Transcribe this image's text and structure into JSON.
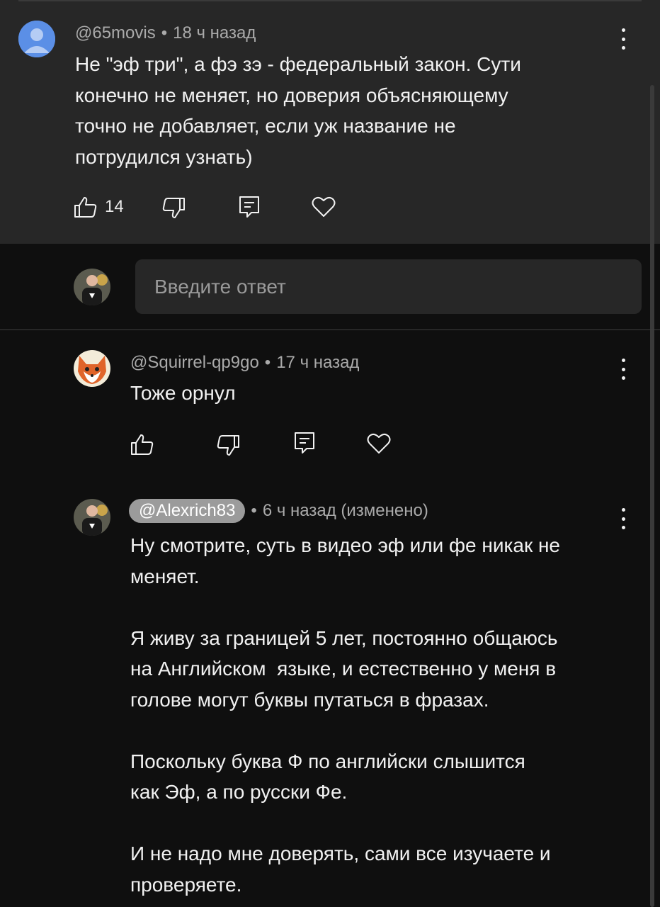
{
  "comment": {
    "author": "@65movis",
    "time": "18 ч назад",
    "text": "Не \"эф три\", а фэ зэ - федеральный закон. Сути\nконечно не меняет, но доверия объясняющему\nточно не добавляет, если уж название не\nпотрудился узнать)",
    "likes": "14",
    "avatar_color": "#4a7fd4"
  },
  "reply_input": {
    "placeholder": "Введите ответ"
  },
  "replies": [
    {
      "author": "@Squirrel-qp9go",
      "time": "17 ч назад",
      "text": "Тоже орнул"
    },
    {
      "author": "@Alexrich83",
      "time": "6 ч назад (изменено)",
      "text": "Ну смотрите, суть в видео эф или фе никак не\nменяет.\n\nЯ живу за границей 5 лет, постоянно общаюсь\nна Английском  языке, и естественно у меня в\nголове могут буквы путаться в фразах.\n\nПоскольку буква Ф по английски слышится\nкак Эф, а по русски Фе.\n\nИ не надо мне доверять, сами все изучаете и\nпроверяете."
    }
  ],
  "separator": "•",
  "icons": [
    "like-icon",
    "dislike-icon",
    "reply-icon",
    "heart-icon",
    "more-vert-icon"
  ]
}
